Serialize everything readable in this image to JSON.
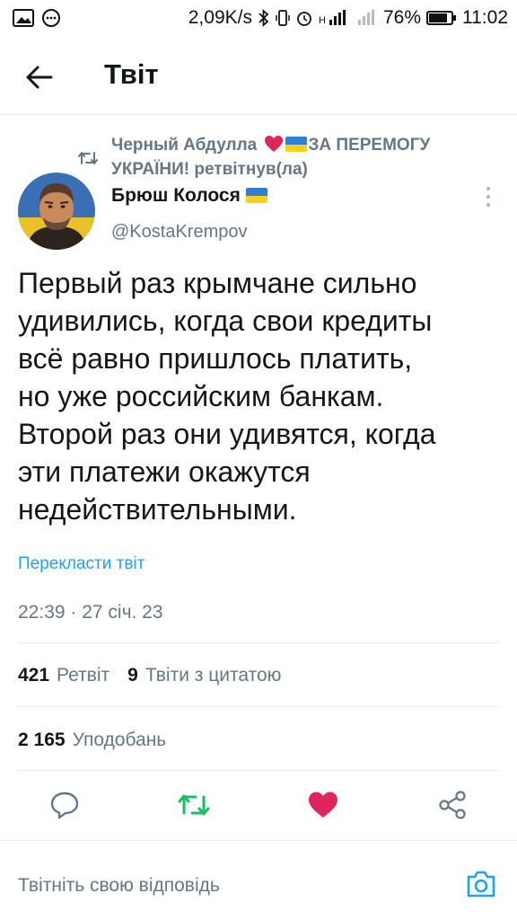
{
  "status_bar": {
    "speed": "2,09K/s",
    "battery": "76%",
    "time": "11:02"
  },
  "header": {
    "title": "Твіт"
  },
  "retweet_context": {
    "line_part1": "Черный Абдулла",
    "line_part2": "ЗА ПЕРЕМОГУ",
    "line_part3": "УКРАЇНИ! ретвітнув(ла)"
  },
  "author": {
    "name": "Брюш Колося",
    "handle": "@KostaKrempov"
  },
  "tweet": {
    "lines": [
      "Первый раз крымчане сильно",
      "удивились, когда свои кредиты",
      "всё равно пришлось платить,",
      "но уже российским банкам.",
      "Второй раз они удивятся, когда",
      "эти платежи окажутся",
      "недействительными."
    ],
    "translate_label": "Перекласти твіт",
    "timestamp": "22:39 · 27 січ. 23"
  },
  "stats": {
    "retweets_count": "421",
    "retweets_label": "Ретвіт",
    "quotes_count": "9",
    "quotes_label": "Твіти з цитатою",
    "likes_count": "2 165",
    "likes_label": "Уподобань"
  },
  "colors": {
    "accent": "#1da1f2",
    "retweet_green": "#17bf63",
    "like_pink": "#e0245e",
    "muted": "#657786"
  },
  "actions": {
    "icons": [
      "reply-icon",
      "retweet-icon",
      "like-icon",
      "share-icon"
    ]
  },
  "reply": {
    "placeholder": "Твітніть свою відповідь"
  }
}
